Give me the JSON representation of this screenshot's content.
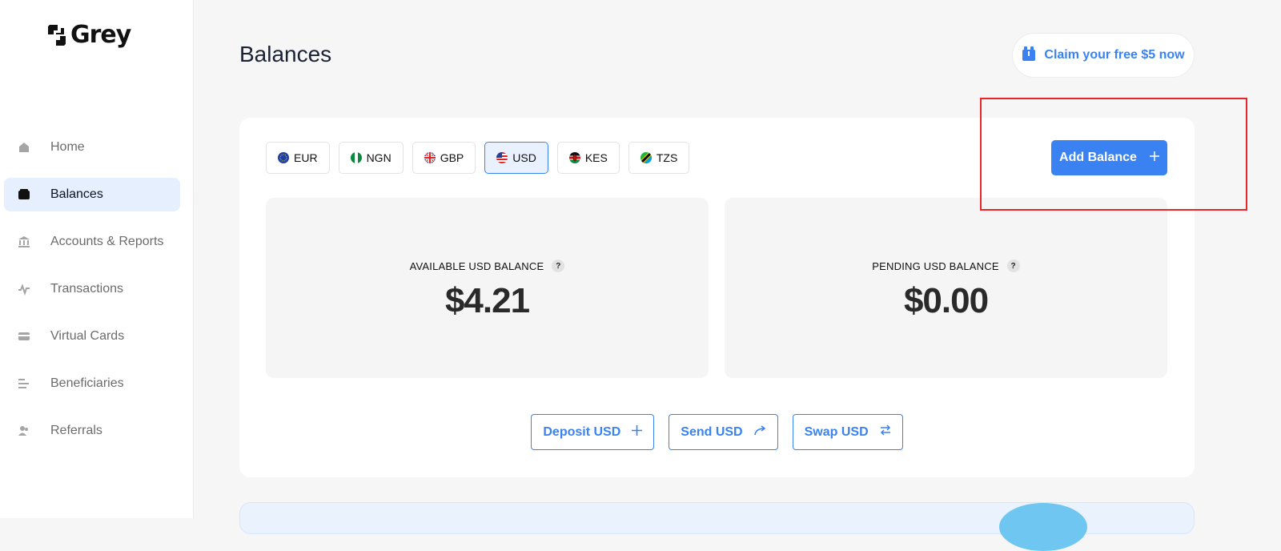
{
  "brand": {
    "name": "Grey"
  },
  "sidebar": {
    "items": [
      {
        "label": "Home",
        "icon": "home-icon",
        "active": false
      },
      {
        "label": "Balances",
        "icon": "wallet-icon",
        "active": true
      },
      {
        "label": "Accounts & Reports",
        "icon": "bank-icon",
        "active": false
      },
      {
        "label": "Transactions",
        "icon": "activity-icon",
        "active": false
      },
      {
        "label": "Virtual Cards",
        "icon": "card-icon",
        "active": false
      },
      {
        "label": "Beneficiaries",
        "icon": "list-icon",
        "active": false
      },
      {
        "label": "Referrals",
        "icon": "users-icon",
        "active": false
      }
    ]
  },
  "header": {
    "title": "Balances",
    "claim_label": "Claim your free $5 now"
  },
  "currency_tabs": [
    {
      "code": "EUR",
      "active": false
    },
    {
      "code": "NGN",
      "active": false
    },
    {
      "code": "GBP",
      "active": false
    },
    {
      "code": "USD",
      "active": true
    },
    {
      "code": "KES",
      "active": false
    },
    {
      "code": "TZS",
      "active": false
    }
  ],
  "add_balance_label": "Add Balance",
  "balances": {
    "available_label": "AVAILABLE USD BALANCE",
    "available_amount": "$4.21",
    "pending_label": "PENDING USD BALANCE",
    "pending_amount": "$0.00",
    "help_glyph": "?"
  },
  "actions": {
    "deposit_label": "Deposit USD",
    "send_label": "Send USD",
    "swap_label": "Swap USD"
  },
  "colors": {
    "accent": "#3a82f2",
    "active_nav_bg": "#e5effd",
    "highlight": "#e8262b"
  }
}
